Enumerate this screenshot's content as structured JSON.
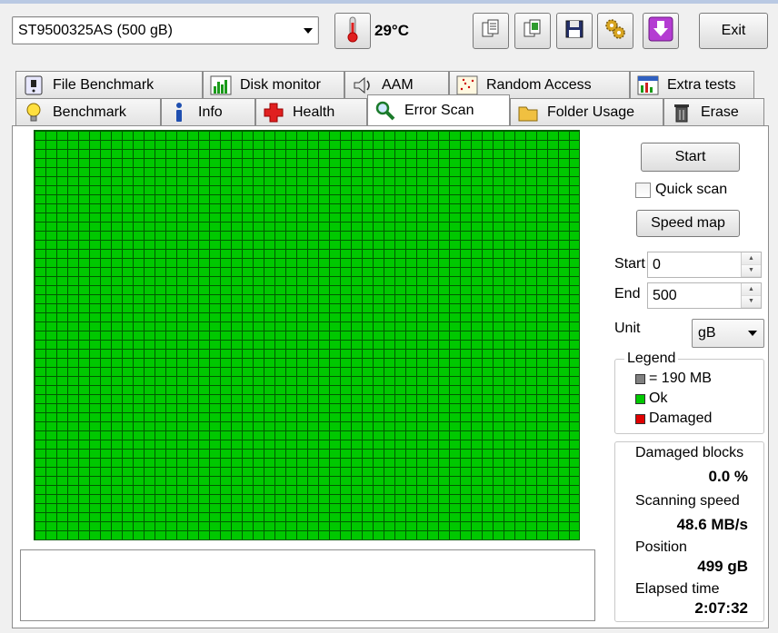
{
  "toolbar": {
    "drive": "ST9500325AS (500 gB)",
    "temperature": "29°C",
    "exit_label": "Exit"
  },
  "tabs_row1": [
    {
      "label": "File Benchmark",
      "icon": "file-benchmark-icon"
    },
    {
      "label": "Disk monitor",
      "icon": "disk-monitor-icon"
    },
    {
      "label": "AAM",
      "icon": "speaker-icon"
    },
    {
      "label": "Random Access",
      "icon": "random-access-icon"
    },
    {
      "label": "Extra tests",
      "icon": "extra-tests-icon"
    }
  ],
  "tabs_row2": [
    {
      "label": "Benchmark",
      "icon": "lightbulb-icon"
    },
    {
      "label": "Info",
      "icon": "info-icon"
    },
    {
      "label": "Health",
      "icon": "health-cross-icon"
    },
    {
      "label": "Error Scan",
      "icon": "magnifier-icon",
      "active": true
    },
    {
      "label": "Folder Usage",
      "icon": "folder-icon"
    },
    {
      "label": "Erase",
      "icon": "trash-icon"
    }
  ],
  "scan": {
    "start_button": "Start",
    "quick_scan_label": "Quick scan",
    "quick_scan_checked": false,
    "speed_map_button": "Speed map",
    "start_label": "Start",
    "start_value": "0",
    "end_label": "End",
    "end_value": "500",
    "unit_label": "Unit",
    "unit_value": "gB",
    "block_color": "#00c800",
    "block_grid": {
      "columns": 50,
      "rows": 45
    }
  },
  "legend": {
    "title": "Legend",
    "items": [
      {
        "label": "= 190 MB",
        "color": "#808080"
      },
      {
        "label": "Ok",
        "color": "#00c800"
      },
      {
        "label": "Damaged",
        "color": "#e00000"
      }
    ]
  },
  "stats": {
    "damaged_label": "Damaged blocks",
    "damaged_value": "0.0 %",
    "speed_label": "Scanning speed",
    "speed_value": "48.6 MB/s",
    "position_label": "Position",
    "position_value": "499 gB",
    "elapsed_label": "Elapsed time",
    "elapsed_value": "2:07:32"
  }
}
